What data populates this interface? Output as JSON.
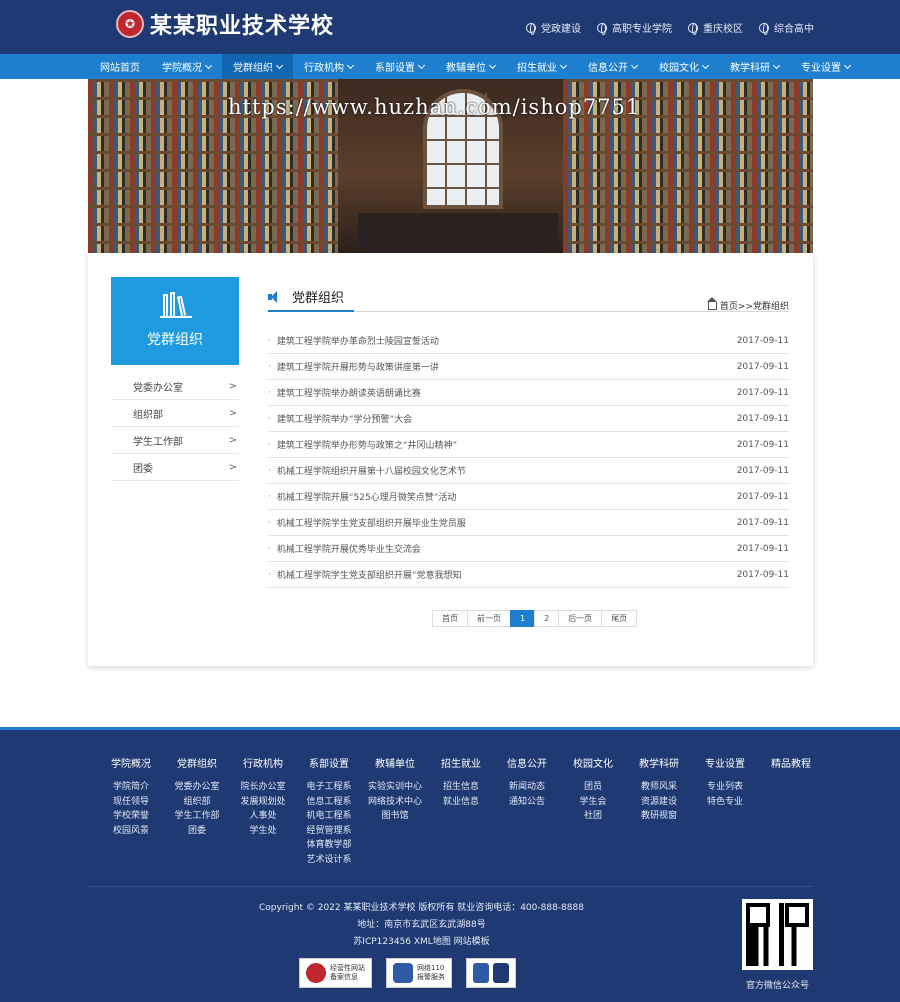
{
  "header": {
    "school_name": "某某职业技术学校",
    "links": [
      "党政建设",
      "高职专业学院",
      "重庆校区",
      "综合高中"
    ]
  },
  "nav": {
    "items": [
      {
        "label": "网站首页",
        "caret": false
      },
      {
        "label": "学院概况",
        "caret": true
      },
      {
        "label": "党群组织",
        "caret": true,
        "active": true
      },
      {
        "label": "行政机构",
        "caret": true
      },
      {
        "label": "系部设置",
        "caret": true
      },
      {
        "label": "教辅单位",
        "caret": true
      },
      {
        "label": "招生就业",
        "caret": true
      },
      {
        "label": "信息公开",
        "caret": true
      },
      {
        "label": "校园文化",
        "caret": true
      },
      {
        "label": "教学科研",
        "caret": true
      },
      {
        "label": "专业设置",
        "caret": true
      }
    ]
  },
  "banner": {
    "watermark": "https://www.huzhan.com/ishop7751"
  },
  "sidebar": {
    "heading": "党群组织",
    "items": [
      {
        "label": "党委办公室",
        "arrow": ">"
      },
      {
        "label": "组织部",
        "arrow": ">"
      },
      {
        "label": "学生工作部",
        "arrow": ">"
      },
      {
        "label": "团委",
        "arrow": ">"
      }
    ]
  },
  "main": {
    "title": "党群组织",
    "breadcrumb": "首页>>党群组织",
    "bullet": "·",
    "articles": [
      {
        "title": "建筑工程学院举办革命烈士陵园宣誓活动",
        "date": "2017-09-11"
      },
      {
        "title": "建筑工程学院开展形势与政策讲座第一讲",
        "date": "2017-09-11"
      },
      {
        "title": "建筑工程学院举办朗读英语朗诵比赛",
        "date": "2017-09-11"
      },
      {
        "title": "建筑工程学院举办“学分预警”大会",
        "date": "2017-09-11"
      },
      {
        "title": "建筑工程学院举办形势与政策之“井冈山精神”",
        "date": "2017-09-11"
      },
      {
        "title": "机械工程学院组织开展第十八届校园文化艺术节",
        "date": "2017-09-11"
      },
      {
        "title": "机械工程学院开展“525心理月微笑点赞”活动",
        "date": "2017-09-11"
      },
      {
        "title": "机械工程学院学生党支部组织开展毕业生党员服",
        "date": "2017-09-11"
      },
      {
        "title": "机械工程学院开展优秀毕业生交流会",
        "date": "2017-09-11"
      },
      {
        "title": "机械工程学院学生党支部组织开展“党意我想知",
        "date": "2017-09-11"
      }
    ],
    "pager": {
      "first": "首页",
      "prev": "前一页",
      "pages": [
        "1",
        "2"
      ],
      "current": "1",
      "next": "后一页",
      "last": "尾页"
    }
  },
  "footer": {
    "columns": [
      {
        "heading": "学院概况",
        "items": [
          "学院简介",
          "现任领导",
          "学校荣誉",
          "校园风景"
        ]
      },
      {
        "heading": "党群组织",
        "items": [
          "党委办公室",
          "组织部",
          "学生工作部",
          "团委"
        ]
      },
      {
        "heading": "行政机构",
        "items": [
          "院长办公室",
          "发展规划处",
          "人事处",
          "学生处"
        ]
      },
      {
        "heading": "系部设置",
        "items": [
          "电子工程系",
          "信息工程系",
          "机电工程系",
          "经贸管理系",
          "体育教学部",
          "艺术设计系"
        ]
      },
      {
        "heading": "教辅单位",
        "items": [
          "实验实训中心",
          "网络技术中心",
          "图书馆"
        ]
      },
      {
        "heading": "招生就业",
        "items": [
          "招生信息",
          "就业信息"
        ]
      },
      {
        "heading": "信息公开",
        "items": [
          "新闻动态",
          "通知公告"
        ]
      },
      {
        "heading": "校园文化",
        "items": [
          "团员",
          "学生会",
          "社团"
        ]
      },
      {
        "heading": "教学科研",
        "items": [
          "教师风采",
          "资源建设",
          "教研视窗"
        ]
      },
      {
        "heading": "专业设置",
        "items": [
          "专业列表",
          "特色专业"
        ]
      },
      {
        "heading": "精品教程",
        "items": []
      }
    ],
    "copyright": "Copyright © 2022 某某职业技术学校 版权所有 就业咨询电话：400-888-8888",
    "address": "地址：南京市玄武区玄武湖88号",
    "icp": "苏ICP123456 XML地图 网站模板",
    "badges": [
      {
        "line1": "经营性网站",
        "line2": "备案信息",
        "color": "#c0262d"
      },
      {
        "line1": "网络110",
        "line2": "报警服务",
        "color": "#2f5aa6"
      },
      {
        "line1": "",
        "line2": "",
        "color": "#2f5aa6"
      }
    ],
    "qr_caption": "官方微信公众号"
  },
  "colors": {
    "navy": "#1f3a73",
    "accent": "#1d7fce",
    "sidebar_head": "#1e9ae0",
    "emblem": "#c0262d"
  }
}
